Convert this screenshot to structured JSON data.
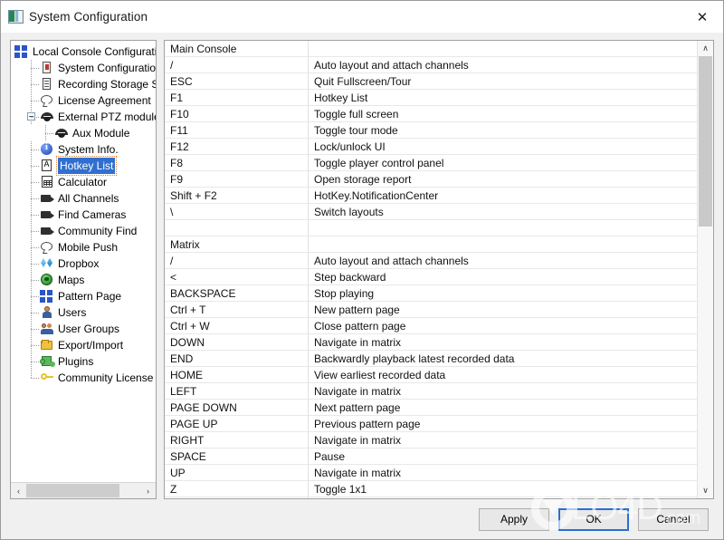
{
  "window": {
    "title": "System Configuration",
    "icon": "app-icon",
    "close_label": "✕"
  },
  "tree": {
    "items": [
      {
        "label": "Local Console Configurati",
        "icon": "grid-icon",
        "level": 1,
        "selected": false,
        "expander": false
      },
      {
        "label": "System Configuration",
        "icon": "document-icon",
        "level": 2,
        "selected": false,
        "expander": false
      },
      {
        "label": "Recording Storage Se",
        "icon": "server-icon",
        "level": 2,
        "selected": false,
        "expander": false
      },
      {
        "label": "License Agreement",
        "icon": "speech-bubble-icon",
        "level": 2,
        "selected": false,
        "expander": false
      },
      {
        "label": "External PTZ module",
        "icon": "ptz-camera-icon",
        "level": 2,
        "selected": false,
        "expander": true
      },
      {
        "label": "Aux Module",
        "icon": "ptz-camera-icon",
        "level": 3,
        "selected": false,
        "expander": false
      },
      {
        "label": "System Info.",
        "icon": "info-icon",
        "level": 2,
        "selected": false,
        "expander": false
      },
      {
        "label": "Hotkey List",
        "icon": "hotkey-icon",
        "level": 2,
        "selected": true,
        "expander": false
      },
      {
        "label": "Calculator",
        "icon": "calculator-icon",
        "level": 2,
        "selected": false,
        "expander": false
      },
      {
        "label": "All Channels",
        "icon": "camera-icon",
        "level": 2,
        "selected": false,
        "expander": false
      },
      {
        "label": "Find Cameras",
        "icon": "camera-icon",
        "level": 2,
        "selected": false,
        "expander": false
      },
      {
        "label": "Community Find",
        "icon": "camera-icon",
        "level": 2,
        "selected": false,
        "expander": false
      },
      {
        "label": "Mobile Push",
        "icon": "speech-bubble-icon",
        "level": 2,
        "selected": false,
        "expander": false
      },
      {
        "label": "Dropbox",
        "icon": "dropbox-icon",
        "level": 2,
        "selected": false,
        "expander": false
      },
      {
        "label": "Maps",
        "icon": "globe-icon",
        "level": 2,
        "selected": false,
        "expander": false
      },
      {
        "label": "Pattern Page",
        "icon": "grid-icon",
        "level": 2,
        "selected": false,
        "expander": false
      },
      {
        "label": "Users",
        "icon": "user-icon",
        "level": 2,
        "selected": false,
        "expander": false
      },
      {
        "label": "User Groups",
        "icon": "users-icon",
        "level": 2,
        "selected": false,
        "expander": false
      },
      {
        "label": "Export/Import",
        "icon": "folder-icon",
        "level": 2,
        "selected": false,
        "expander": false
      },
      {
        "label": "Plugins",
        "icon": "plugin-icon",
        "level": 2,
        "selected": false,
        "expander": false
      },
      {
        "label": "Community License M",
        "icon": "key-icon",
        "level": 2,
        "selected": false,
        "expander": false
      }
    ],
    "hscroll": {
      "left_label": "‹",
      "right_label": "›"
    }
  },
  "hotkey_list": {
    "vscroll": {
      "up_label": "∧",
      "down_label": "∨"
    },
    "rows": [
      {
        "key": "Main Console",
        "action": "",
        "section": true
      },
      {
        "key": "/",
        "action": "Auto layout and attach channels"
      },
      {
        "key": "ESC",
        "action": "Quit Fullscreen/Tour"
      },
      {
        "key": "F1",
        "action": "Hotkey List"
      },
      {
        "key": "F10",
        "action": "Toggle full screen"
      },
      {
        "key": "F11",
        "action": "Toggle tour mode"
      },
      {
        "key": "F12",
        "action": "Lock/unlock UI"
      },
      {
        "key": "F8",
        "action": "Toggle player control panel"
      },
      {
        "key": "F9",
        "action": "Open storage report"
      },
      {
        "key": "Shift + F2",
        "action": "HotKey.NotificationCenter"
      },
      {
        "key": "\\",
        "action": "Switch layouts"
      },
      {
        "key": "",
        "action": ""
      },
      {
        "key": "Matrix",
        "action": "",
        "section": true
      },
      {
        "key": "/",
        "action": "Auto layout and attach channels"
      },
      {
        "key": "<",
        "action": "Step backward"
      },
      {
        "key": "BACKSPACE",
        "action": "Stop playing"
      },
      {
        "key": "Ctrl + T",
        "action": "New pattern page"
      },
      {
        "key": "Ctrl + W",
        "action": "Close pattern page"
      },
      {
        "key": "DOWN",
        "action": "Navigate in matrix"
      },
      {
        "key": "END",
        "action": "Backwardly playback latest recorded data"
      },
      {
        "key": "HOME",
        "action": "View earliest recorded data"
      },
      {
        "key": "LEFT",
        "action": "Navigate in matrix"
      },
      {
        "key": "PAGE DOWN",
        "action": "Next pattern page"
      },
      {
        "key": "PAGE UP",
        "action": "Previous pattern page"
      },
      {
        "key": "RIGHT",
        "action": "Navigate in matrix"
      },
      {
        "key": "SPACE",
        "action": "Pause"
      },
      {
        "key": "UP",
        "action": "Navigate in matrix"
      },
      {
        "key": "Z",
        "action": "Toggle 1x1"
      }
    ]
  },
  "footer": {
    "apply_label": "Apply",
    "ok_label": "OK",
    "cancel_label": "Cancel"
  },
  "watermark": {
    "text": "LO4D",
    "suffix": ".com"
  },
  "colors": {
    "selection_blue": "#2f6fd0",
    "default_button_border": "#2a6ed5",
    "window_bg": "#f0f0f0"
  }
}
